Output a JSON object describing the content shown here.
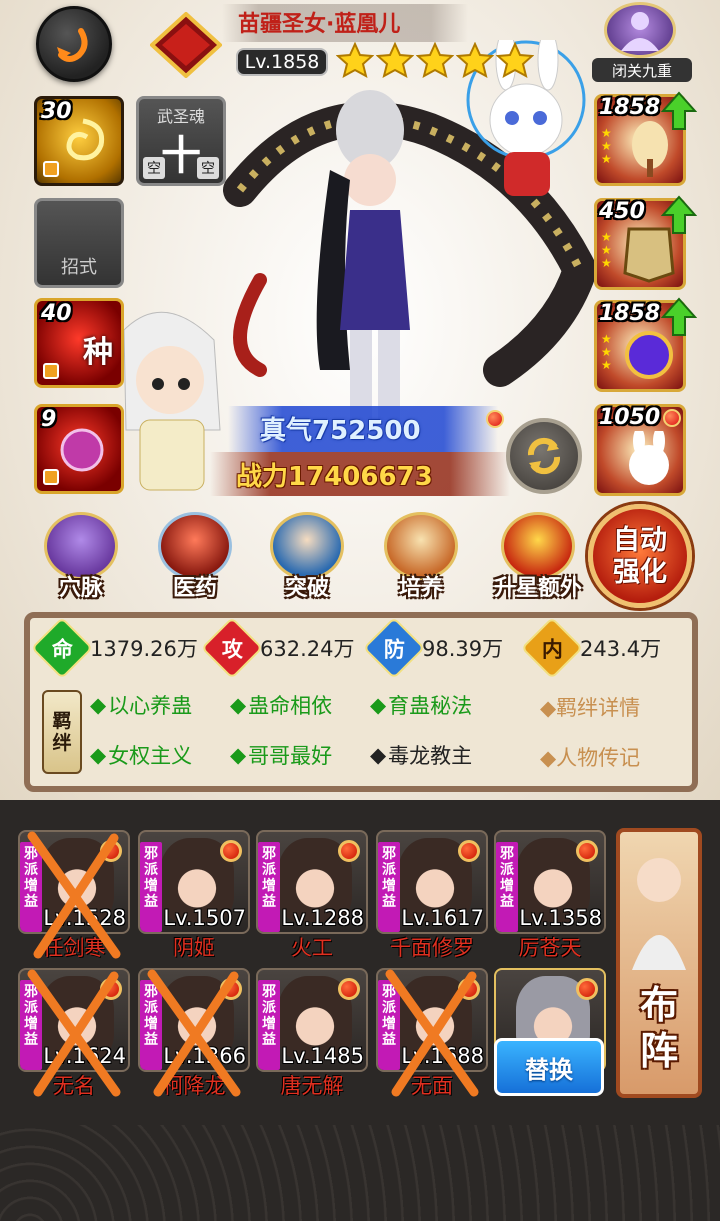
{
  "header": {
    "hero_name": "苗疆圣女·蓝凰儿",
    "level": "Lv.1858",
    "star_count": 5,
    "seclusion_label": "闭关九重"
  },
  "left_slots": {
    "slot1_value": "30",
    "soul_title": "武圣魂",
    "soul_char": "十",
    "soul_empty_left": "空",
    "soul_empty_right": "空",
    "move_label": "招式",
    "slot3_value": "40",
    "slot3_char": "种",
    "slot4_value": "9"
  },
  "right_equips": {
    "items": [
      {
        "level": "1858"
      },
      {
        "level": "450"
      },
      {
        "level": "1858"
      },
      {
        "level": "1050"
      }
    ]
  },
  "power": {
    "qi": "真气752500",
    "combat": "战力17406673"
  },
  "functions": [
    {
      "label": "穴脉"
    },
    {
      "label": "医药"
    },
    {
      "label": "突破"
    },
    {
      "label": "培养"
    },
    {
      "label": "升星额外"
    }
  ],
  "auto": {
    "line1": "自动",
    "line2": "强化"
  },
  "stats": [
    {
      "badge": "命",
      "value": "1379.26万",
      "color": "#1faa2a"
    },
    {
      "badge": "攻",
      "value": "632.24万",
      "color": "#d8202a"
    },
    {
      "badge": "防",
      "value": "98.39万",
      "color": "#2a7ad8"
    },
    {
      "badge": "内",
      "value": "243.4万",
      "color": "#e8a018"
    }
  ],
  "bonds": {
    "tag_line1": "羁",
    "tag_line2": "绊",
    "row1": [
      "以心养蛊",
      "蛊命相依",
      "育蛊秘法"
    ],
    "row2": [
      "女权主义",
      "哥哥最好"
    ],
    "row2_off": "毒龙教主",
    "link1": "羁绊详情",
    "link2": "人物传记"
  },
  "team": {
    "tag": "邪派增益",
    "row1": [
      {
        "level": "Lv.1528",
        "name": "任剑寒",
        "crossed": true
      },
      {
        "level": "Lv.1507",
        "name": "阴姬",
        "crossed": false
      },
      {
        "level": "Lv.1288",
        "name": "火工",
        "crossed": false
      },
      {
        "level": "Lv.1617",
        "name": "千面修罗",
        "crossed": false
      },
      {
        "level": "Lv.1358",
        "name": "厉苍天",
        "crossed": false
      }
    ],
    "row2": [
      {
        "level": "Lv.1624",
        "name": "无名",
        "crossed": true
      },
      {
        "level": "Lv.1366",
        "name": "柯降龙",
        "crossed": true
      },
      {
        "level": "Lv.1485",
        "name": "唐无解",
        "crossed": false
      },
      {
        "level": "Lv.1688",
        "name": "无面",
        "crossed": true
      }
    ],
    "swap_label": "替换",
    "formation_line1": "布",
    "formation_line2": "阵"
  },
  "colors": {
    "cross": "#f07a22",
    "name_red": "#c02018",
    "bond_green": "#1a9a1a"
  }
}
